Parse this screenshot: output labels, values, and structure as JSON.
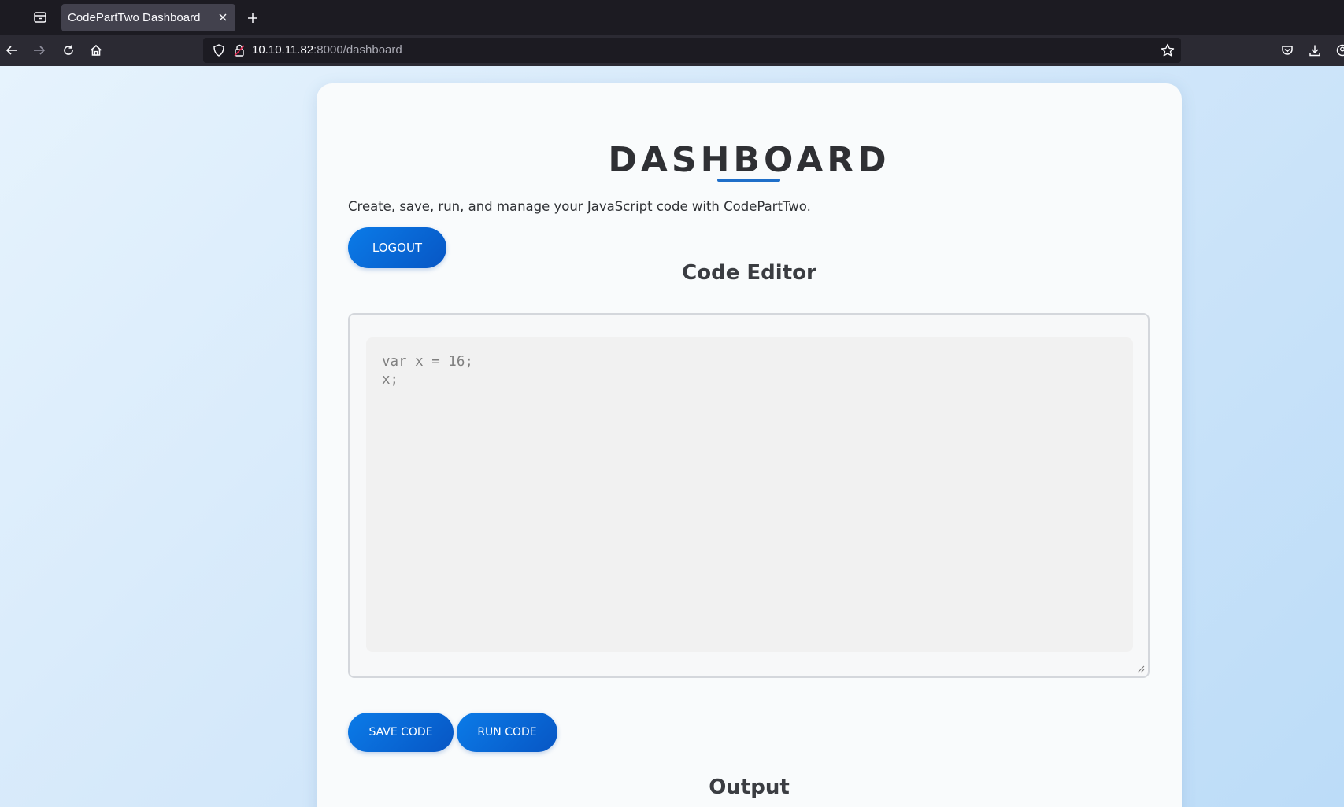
{
  "browser": {
    "tab": {
      "title": "CodePartTwo Dashboard"
    },
    "url": {
      "host": "10.10.11.82",
      "rest": ":8000/dashboard"
    },
    "icons": {
      "tab_list": "tab-list-icon",
      "close": "close-icon",
      "new_tab": "plus-icon",
      "back": "arrow-left-icon",
      "forward": "arrow-right-icon",
      "reload": "reload-icon",
      "home": "home-icon",
      "shield": "shield-icon",
      "lock": "lock-icon",
      "bookmark": "star-icon",
      "pocket": "pocket-icon",
      "downloads": "download-icon",
      "account": "account-icon"
    }
  },
  "page": {
    "title": "DASHBOARD",
    "intro": "Create, save, run, and manage your JavaScript code with CodePartTwo.",
    "logout_label": "LOGOUT",
    "editor_heading": "Code Editor",
    "code": "var x = 16;\nx;",
    "save_label": "SAVE CODE",
    "run_label": "RUN CODE",
    "output_heading": "Output"
  },
  "colors": {
    "accent": "#0b6ad8",
    "underline": "#1f6fc9",
    "page_bg": "#d4e8fa",
    "card_bg": "#f9fbfc"
  }
}
